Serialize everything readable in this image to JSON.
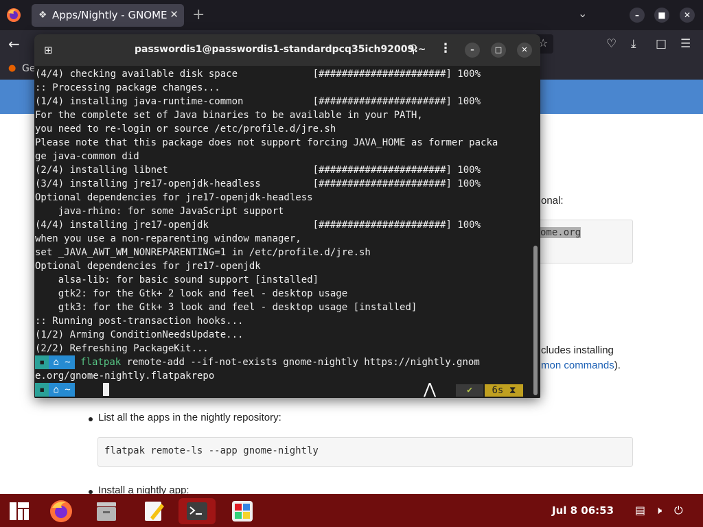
{
  "browser": {
    "tab_title": "Apps/Nightly - GNOME ",
    "bookmark_label": "Ge",
    "icons": [
      "firefox-menu-icon",
      "gnome-tab-icon",
      "close-icon",
      "plus-icon",
      "chevron-down-icon",
      "minimize-icon",
      "maximize-icon",
      "close-icon",
      "back-arrow-icon",
      "star-icon",
      "pocket-icon",
      "download-icon",
      "extensions-icon",
      "hamburger-menu-icon"
    ]
  },
  "page": {
    "optional_text": "onal:",
    "selected_code": "ome.org",
    "includes_text": "cludes installing",
    "common_link": "mon commands",
    "common_tail": ").",
    "list_item_1": "List all the apps in the nightly repository:",
    "code_1": "flatpak remote-ls --app gnome-nightly",
    "list_item_2": "Install a nightly app:"
  },
  "terminal": {
    "title": "passwordis1@passwordis1-standardpcq35ich92009:~",
    "lines": [
      "(4/4) checking available disk space             [######################] 100%",
      ":: Processing package changes...",
      "(1/4) installing java-runtime-common            [######################] 100%",
      "For the complete set of Java binaries to be available in your PATH,",
      "you need to re-login or source /etc/profile.d/jre.sh",
      "Please note that this package does not support forcing JAVA_HOME as former packa",
      "ge java-common did",
      "(2/4) installing libnet                         [######################] 100%",
      "(3/4) installing jre17-openjdk-headless         [######################] 100%",
      "Optional dependencies for jre17-openjdk-headless",
      "    java-rhino: for some JavaScript support",
      "(4/4) installing jre17-openjdk                  [######################] 100%",
      "when you use a non-reparenting window manager,",
      "set _JAVA_AWT_WM_NONREPARENTING=1 in /etc/profile.d/jre.sh",
      "Optional dependencies for jre17-openjdk",
      "    alsa-lib: for basic sound support [installed]",
      "    gtk2: for the Gtk+ 2 look and feel - desktop usage",
      "    gtk3: for the Gtk+ 3 look and feel - desktop usage [installed]",
      ":: Running post-transaction hooks...",
      "(1/2) Arming ConditionNeedsUpdate...",
      "(2/2) Refreshing PackageKit..."
    ],
    "prompt_os": "▪",
    "prompt_dir": "⌂ ~",
    "command_bin": "flatpak",
    "command_rest": " remote-add --if-not-exists gnome-nightly https://nightly.gnom",
    "command_wrap": "e.org/gnome-nightly.flatpakrepo",
    "status_check": "✔",
    "status_time": "6s ⧗"
  },
  "taskbar": {
    "clock": "Jul 8  06:53"
  }
}
